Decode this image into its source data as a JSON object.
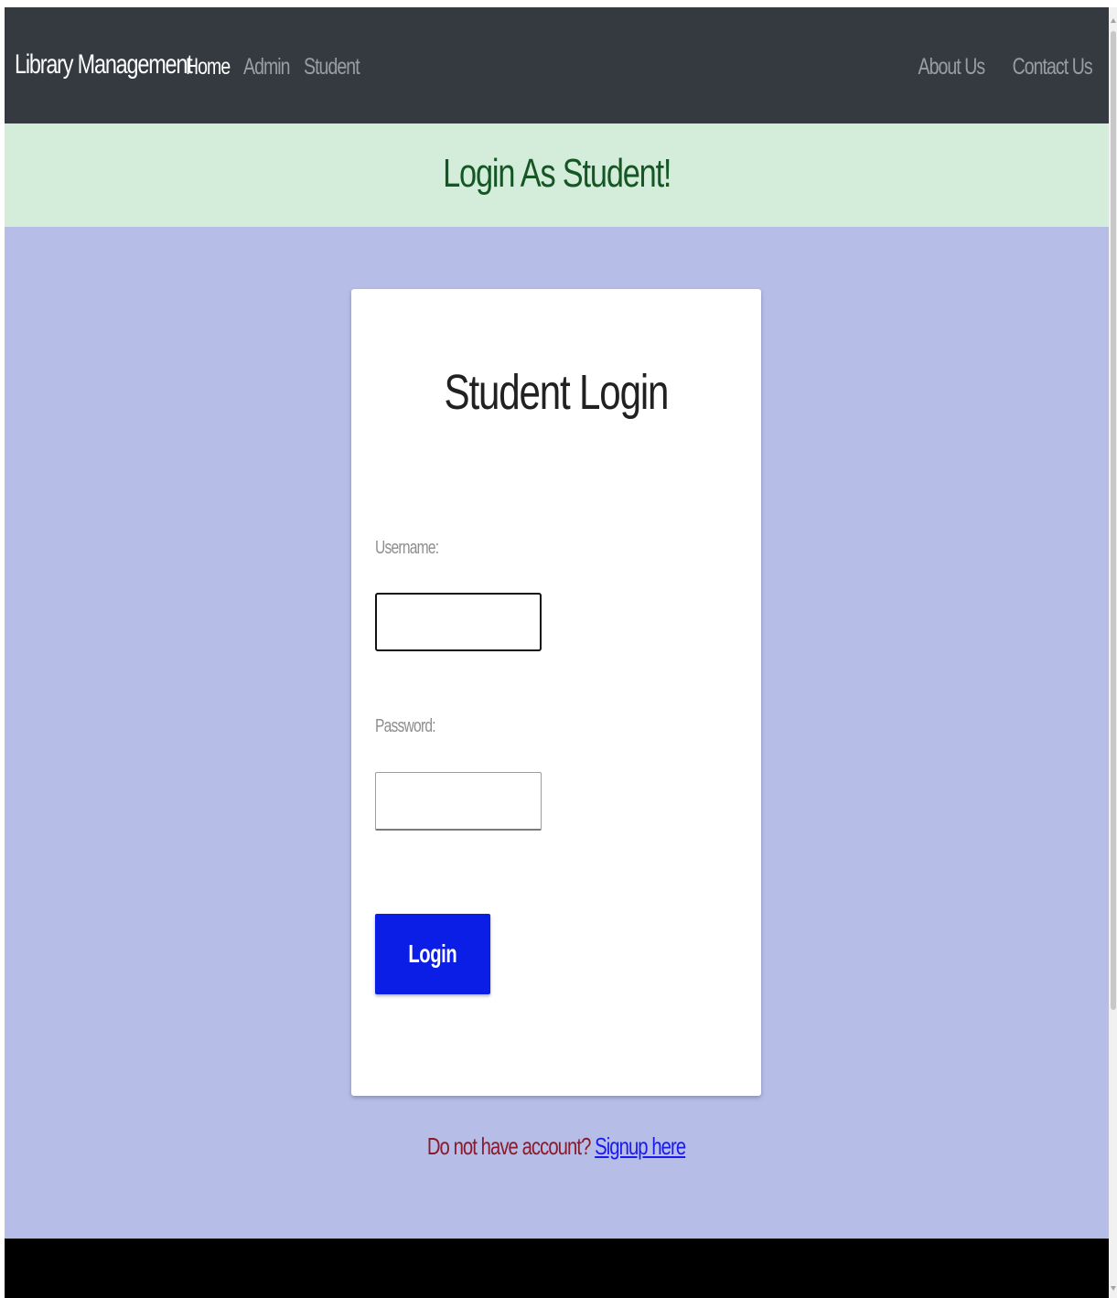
{
  "navbar": {
    "brand": "Library Management",
    "left_links": [
      {
        "label": "Home",
        "active": true
      },
      {
        "label": "Admin",
        "active": false
      },
      {
        "label": "Student",
        "active": false
      }
    ],
    "right_links": [
      {
        "label": "About Us"
      },
      {
        "label": "Contact Us"
      }
    ],
    "background_color": "#343a40"
  },
  "banner": {
    "text": "Login As Student!",
    "background_color": "#d4edda",
    "text_color": "#155724"
  },
  "login_card": {
    "title": "Student Login",
    "username_label": "Username:",
    "username_value": "",
    "password_label": "Password:",
    "password_value": "",
    "login_button_label": "Login",
    "button_color": "#0a1ee6"
  },
  "signup": {
    "prompt": "Do not have account? ",
    "link_text": "Signup here"
  },
  "page": {
    "background_color": "#b6bde7",
    "footer_color": "#000000"
  }
}
